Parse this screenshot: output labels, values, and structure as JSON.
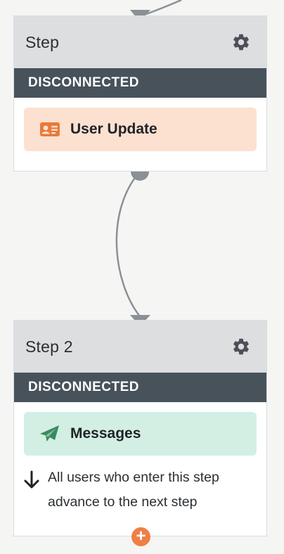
{
  "steps": [
    {
      "title": "Step",
      "status": "DISCONNECTED",
      "action": {
        "label": "User Update",
        "icon": "id-card-icon"
      }
    },
    {
      "title": "Step 2",
      "status": "DISCONNECTED",
      "action": {
        "label": "Messages",
        "icon": "paper-plane-icon"
      },
      "advance_note": "All users who enter this step advance to the next step"
    }
  ],
  "add_button_icon": "plus-icon",
  "colors": {
    "canvas_bg": "#f5f5f4",
    "header_bg": "#dcdee0",
    "status_bar_bg": "#47525b",
    "user_update_bg": "#fce1d1",
    "user_update_icon": "#e87a3b",
    "messages_bg": "#d3efe4",
    "messages_icon": "#3b8a5f",
    "connector": "#8a9196",
    "add_button": "#ee7f45"
  }
}
